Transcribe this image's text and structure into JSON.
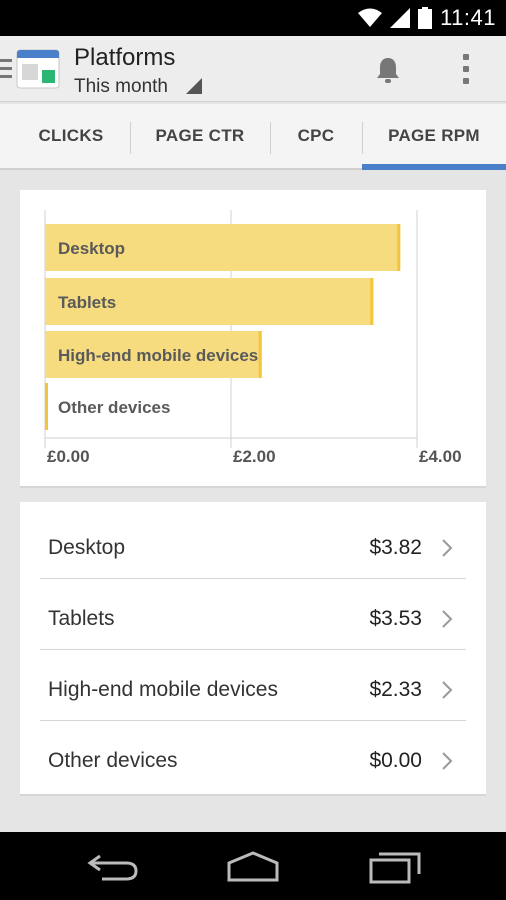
{
  "status_bar": {
    "time": "11:41"
  },
  "app_bar": {
    "title": "Platforms",
    "subtitle": "This month"
  },
  "tabs": [
    {
      "label": "CLICKS",
      "active": false
    },
    {
      "label": "PAGE CTR",
      "active": false
    },
    {
      "label": "CPC",
      "active": false
    },
    {
      "label": "PAGE RPM",
      "active": true
    }
  ],
  "chart_data": {
    "type": "bar",
    "orientation": "horizontal",
    "categories": [
      "Desktop",
      "Tablets",
      "High-end mobile devices",
      "Other devices"
    ],
    "values": [
      3.82,
      3.53,
      2.33,
      0.0
    ],
    "xlim": [
      0,
      4
    ],
    "x_ticks": [
      "£0.00",
      "£2.00",
      "£4.00"
    ],
    "grid": true,
    "bar_color": "#f6dc7f",
    "bar_edge_color": "#f2c53d"
  },
  "list": [
    {
      "name": "Desktop",
      "value": "$3.82"
    },
    {
      "name": "Tablets",
      "value": "$3.53"
    },
    {
      "name": "High-end mobile devices",
      "value": "$2.33"
    },
    {
      "name": "Other devices",
      "value": "$0.00"
    }
  ],
  "nav_bar": {
    "icons": [
      "back-icon",
      "home-icon",
      "recent-apps-icon"
    ]
  },
  "colors": {
    "accent": "#4a7fc9",
    "app_icon_blue": "#4a7fc9",
    "app_icon_green": "#2bb673"
  }
}
